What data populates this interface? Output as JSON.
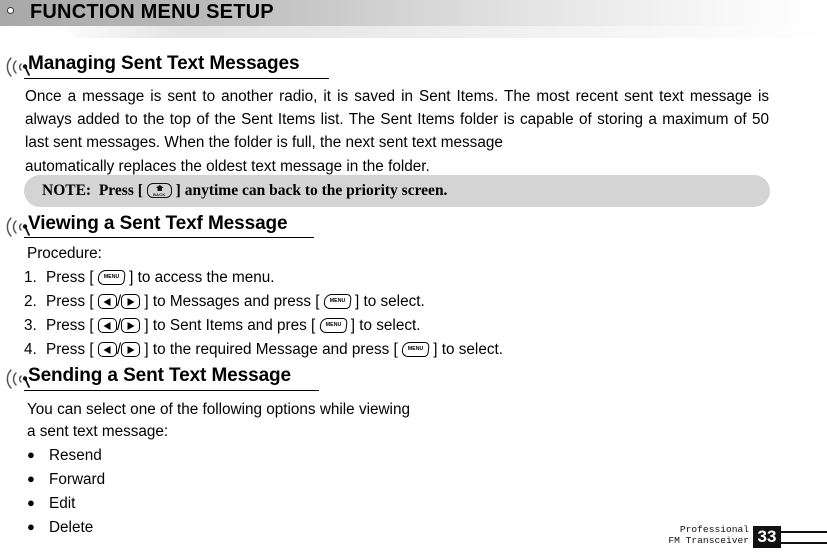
{
  "header": {
    "title": "FUNCTION MENU SETUP",
    "dot_icon": "circle-outline-icon"
  },
  "sections": [
    {
      "id": "managing",
      "icon": "antenna-signal-icon",
      "title": "Managing Sent Text Messages"
    },
    {
      "id": "viewing",
      "icon": "antenna-signal-icon",
      "title": "Viewing a Sent Texf Message"
    },
    {
      "id": "sending",
      "icon": "antenna-signal-icon",
      "title": "Sending a Sent Text Message"
    }
  ],
  "paragraph": {
    "main": "Once a message is sent to another radio, it is saved in Sent Items. The most recent sent text message is always added to the top of the Sent Items list. The Sent Items folder is capable of storing a maximum of 50 last sent messages. When the folder is full, the next sent text message",
    "last_line": "automatically replaces the oldest text message in the folder."
  },
  "note": {
    "label": "NOTE:",
    "before_key": "Press [",
    "key": "BACK",
    "key_icon": "back-key-icon",
    "after_key": "] anytime can back to the priority screen."
  },
  "procedure": {
    "label": "Procedure:",
    "steps": [
      {
        "num": "1.",
        "a": "Press [",
        "keys": [
          "MENU"
        ],
        "b": "] to access the menu.",
        "c": "",
        "keys2": [],
        "d": ""
      },
      {
        "num": "2.",
        "a": "Press [",
        "keys": [
          "LEFT",
          "RIGHT"
        ],
        "b": "] to Messages and press [",
        "keys2": [
          "MENU"
        ],
        "d": "] to select."
      },
      {
        "num": "3.",
        "a": "Press [",
        "keys": [
          "LEFT",
          "RIGHT"
        ],
        "b": "] to Sent Items and pres [",
        "keys2": [
          "MENU"
        ],
        "d": "] to select."
      },
      {
        "num": "4.",
        "a": "Press [",
        "keys": [
          "LEFT",
          "RIGHT"
        ],
        "b": "] to the required Message and press [",
        "keys2": [
          "MENU"
        ],
        "d": "] to select."
      }
    ],
    "slash": "/"
  },
  "options": {
    "intro_line1": "You can select one of the following options while viewing",
    "intro_line2": "a sent text message:",
    "bullet_glyph": "●",
    "items": [
      {
        "label": "Resend"
      },
      {
        "label": "Forward"
      },
      {
        "label": "Edit"
      },
      {
        "label": "Delete"
      }
    ]
  },
  "footer": {
    "brand_line1": "Professional",
    "brand_line2": "FM Transceiver",
    "page_number": "33"
  },
  "colors": {
    "header_gradient_start": "#a8a8a8",
    "header_gradient_end": "#ffffff",
    "note_background": "#d4d4d4",
    "text": "#000000",
    "page_box": "#111111"
  }
}
